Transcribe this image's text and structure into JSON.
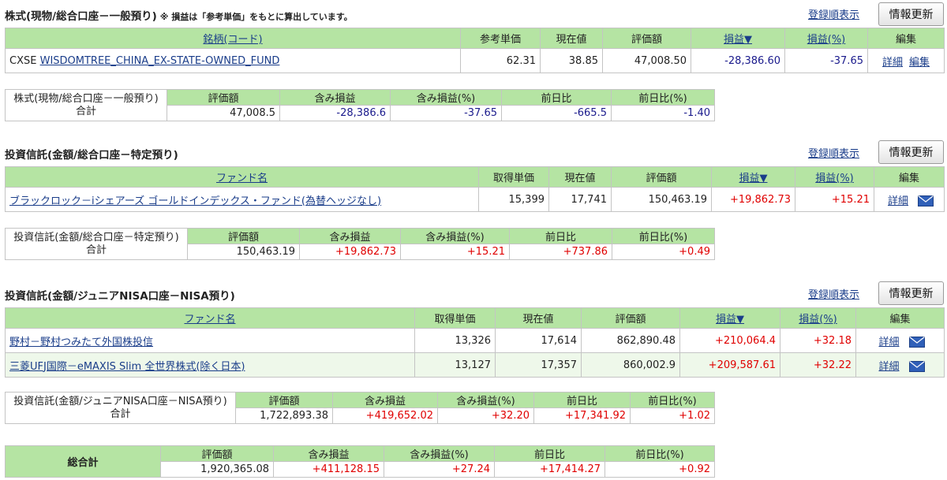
{
  "s1": {
    "title": "株式(現物/総合口座－一般預り)",
    "note": "※ 損益は「参考単価」をもとに算出しています。",
    "sort_link": "登録順表示",
    "refresh": "情報更新",
    "headers": [
      "銘柄(コード)",
      "参考単価",
      "現在値",
      "評価額",
      "損益▼",
      "損益(%)",
      "編集"
    ],
    "rows": [
      {
        "code": "CXSE",
        "name": "WISDOMTREE_CHINA_EX-STATE-OWNED_FUND",
        "unit": "62.31",
        "price": "38.85",
        "value": "47,008.50",
        "pl": "-28,386.60",
        "plpct": "-37.65",
        "detail": "詳細",
        "edit": "編集"
      }
    ],
    "summary": {
      "label_line1": "株式(現物/総合口座－一般預り)",
      "label_line2": "合計",
      "headers": [
        "評価額",
        "含み損益",
        "含み損益(%)",
        "前日比",
        "前日比(%)"
      ],
      "values": [
        "47,008.5",
        "-28,386.6",
        "-37.65",
        "-665.5",
        "-1.40"
      ]
    }
  },
  "s2": {
    "title": "投資信託(金額/総合口座－特定預り)",
    "sort_link": "登録順表示",
    "refresh": "情報更新",
    "headers": [
      "ファンド名",
      "取得単価",
      "現在値",
      "評価額",
      "損益▼",
      "損益(%)",
      "編集"
    ],
    "rows": [
      {
        "name": "ブラックロック－iシェアーズ ゴールドインデックス・ファンド(為替ヘッジなし)",
        "unit": "15,399",
        "price": "17,741",
        "value": "150,463.19",
        "pl": "+19,862.73",
        "plpct": "+15.21",
        "detail": "詳細",
        "mail_icon": "mail-icon"
      }
    ],
    "summary": {
      "label_line1": "投資信託(金額/総合口座－特定預り)",
      "label_line2": "合計",
      "headers": [
        "評価額",
        "含み損益",
        "含み損益(%)",
        "前日比",
        "前日比(%)"
      ],
      "values": [
        "150,463.19",
        "+19,862.73",
        "+15.21",
        "+737.86",
        "+0.49"
      ]
    }
  },
  "s3": {
    "title": "投資信託(金額/ジュニアNISA口座－NISA預り)",
    "sort_link": "登録順表示",
    "refresh": "情報更新",
    "headers": [
      "ファンド名",
      "取得単価",
      "現在値",
      "評価額",
      "損益▼",
      "損益(%)",
      "編集"
    ],
    "rows": [
      {
        "name": "野村－野村つみたて外国株投信",
        "unit": "13,326",
        "price": "17,614",
        "value": "862,890.48",
        "pl": "+210,064.4",
        "plpct": "+32.18",
        "detail": "詳細"
      },
      {
        "name": "三菱UFJ国際－eMAXIS Slim 全世界株式(除く日本)",
        "unit": "13,127",
        "price": "17,357",
        "value": "860,002.9",
        "pl": "+209,587.61",
        "plpct": "+32.22",
        "detail": "詳細"
      }
    ],
    "summary": {
      "label_line1": "投資信託(金額/ジュニアNISA口座－NISA預り)",
      "label_line2": "合計",
      "headers": [
        "評価額",
        "含み損益",
        "含み損益(%)",
        "前日比",
        "前日比(%)"
      ],
      "values": [
        "1,722,893.38",
        "+419,652.02",
        "+32.20",
        "+17,341.92",
        "+1.02"
      ]
    }
  },
  "total": {
    "label": "総合計",
    "headers": [
      "評価額",
      "含み損益",
      "含み損益(%)",
      "前日比",
      "前日比(%)"
    ],
    "values": [
      "1,920,365.08",
      "+411,128.15",
      "+27.24",
      "+17,414.27",
      "+0.92"
    ]
  },
  "colors": {
    "header_green": "#b5e4a3",
    "negative": "#1a1a8c",
    "positive": "#e00000",
    "link": "#1a3d8a"
  }
}
